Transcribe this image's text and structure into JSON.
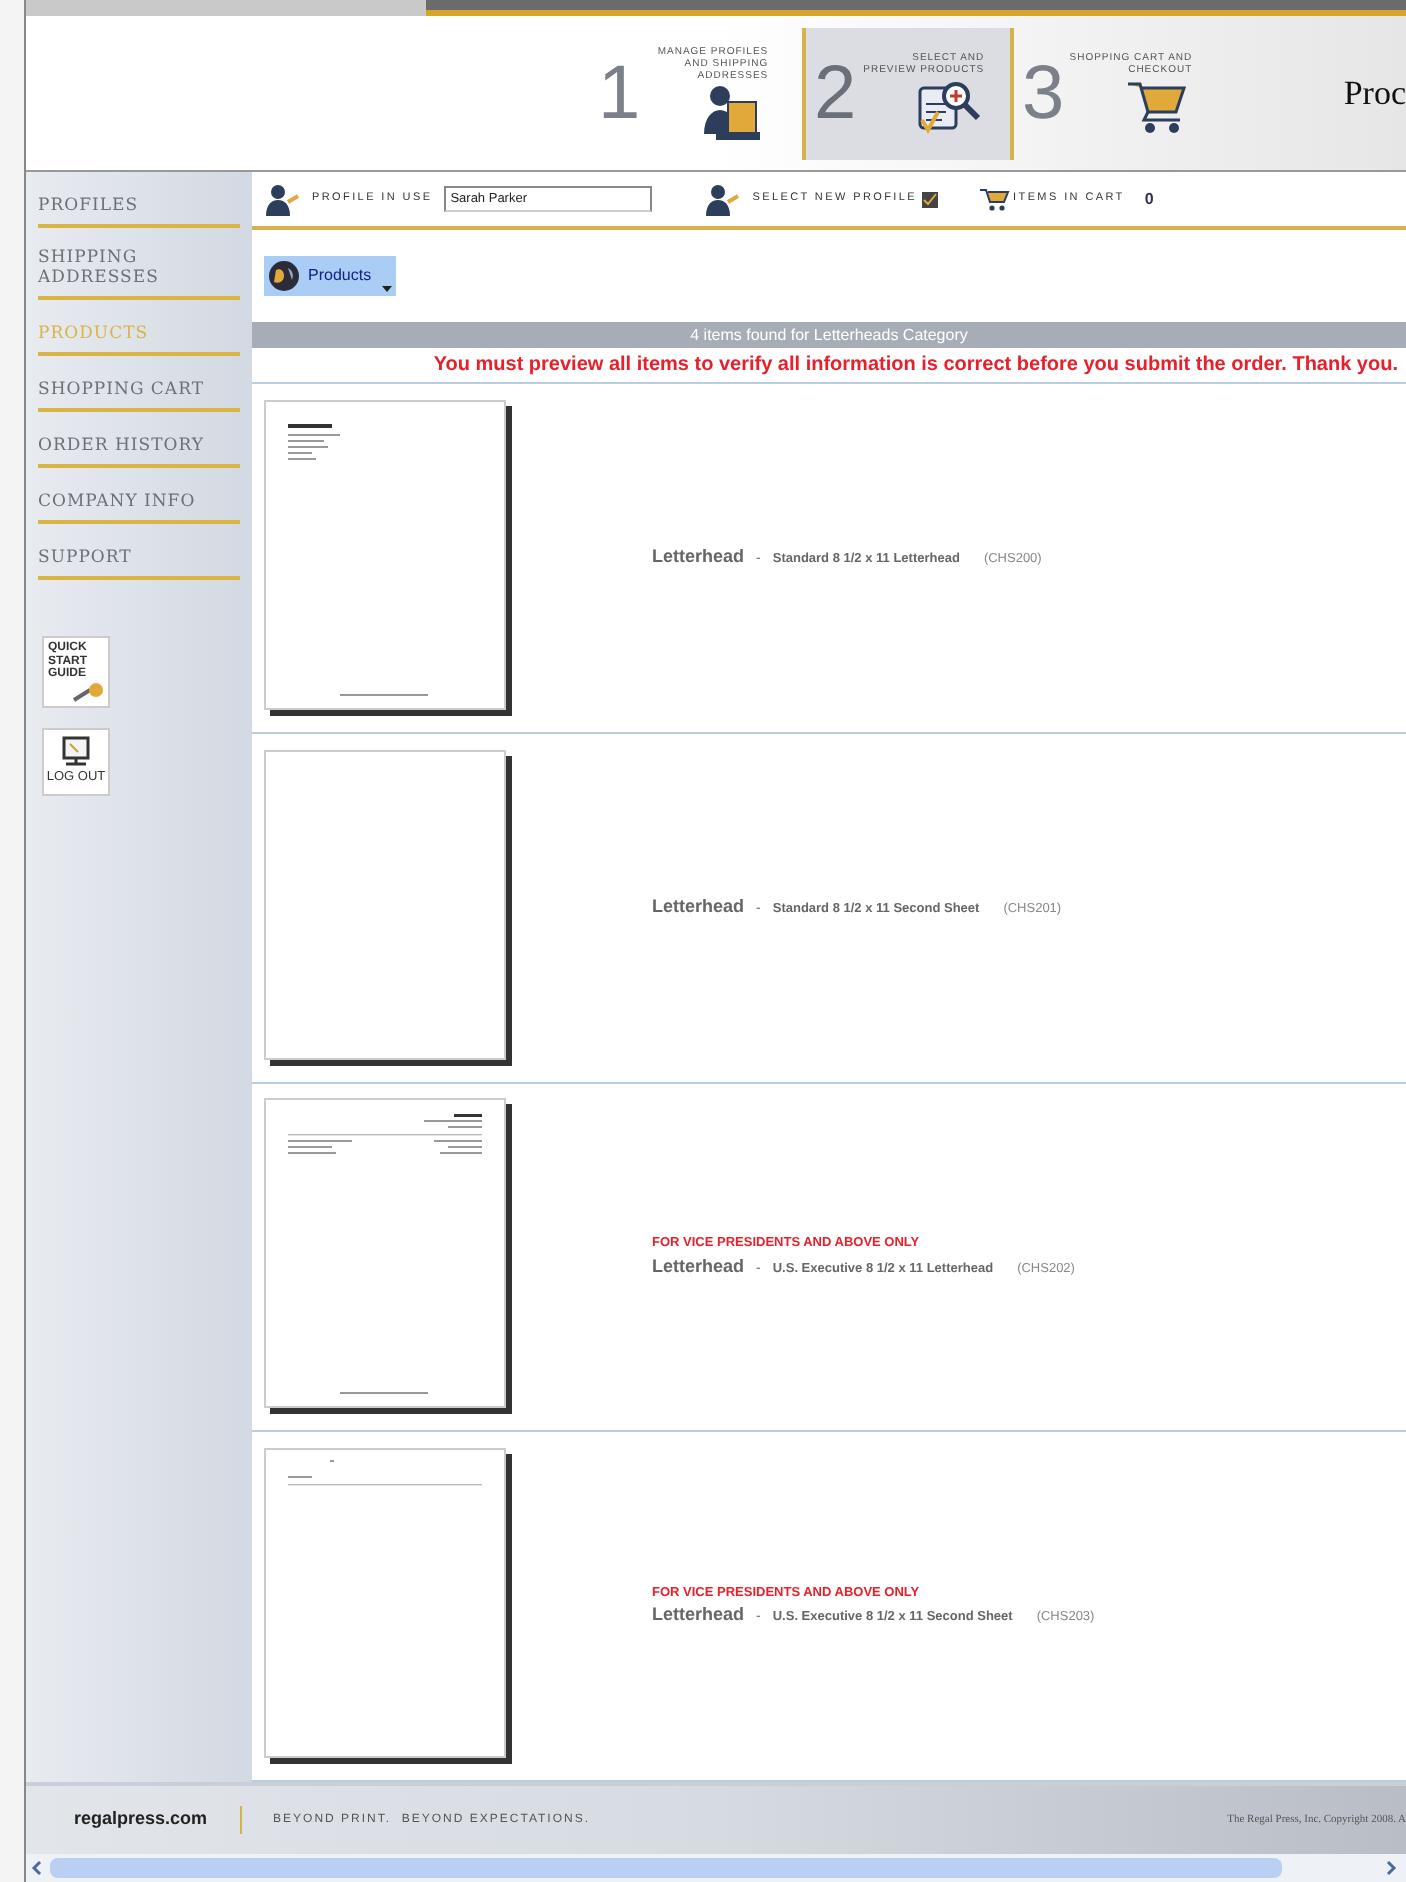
{
  "header": {
    "steps": [
      {
        "number": "1",
        "label": "MANAGE PROFILES AND SHIPPING ADDRESSES",
        "selected": false
      },
      {
        "number": "2",
        "label": "SELECT AND PREVIEW PRODUCTS",
        "selected": true
      },
      {
        "number": "3",
        "label": "SHOPPING CART AND CHECKOUT",
        "selected": false
      }
    ],
    "logo": "Proc"
  },
  "sidebar": {
    "items": [
      {
        "label": "PROFILES",
        "selected": false
      },
      {
        "label": "SHIPPING ADDRESSES",
        "selected": false
      },
      {
        "label": "PRODUCTS",
        "selected": true
      },
      {
        "label": "SHOPPING CART",
        "selected": false
      },
      {
        "label": "ORDER HISTORY",
        "selected": false
      },
      {
        "label": "COMPANY INFO",
        "selected": false
      },
      {
        "label": "SUPPORT",
        "selected": false
      }
    ],
    "quick_start": "QUICK START GUIDE",
    "log_out": "LOG OUT"
  },
  "profile_bar": {
    "profile_label": "PROFILE IN USE",
    "profile_value": "Sarah Parker",
    "select_label": "SELECT NEW PROFILE",
    "cart_label": "ITEMS IN CART",
    "cart_count": "0"
  },
  "products_button": "Products",
  "results_banner": "4 items found for Letterheads Category",
  "warning": "You must preview all items to verify all information is correct before you submit the order. Thank you.",
  "products": [
    {
      "kind": "letter",
      "name": "Letterhead",
      "separator": "-",
      "description": "Standard 8 1/2 x 11 Letterhead",
      "code": "(CHS200)"
    },
    {
      "kind": "blank",
      "name": "Letterhead",
      "separator": "-",
      "description": "Standard 8 1/2 x 11 Second Sheet",
      "code": "(CHS201)"
    },
    {
      "kind": "executive",
      "notice": "FOR VICE PRESIDENTS AND ABOVE ONLY",
      "name": "Letterhead",
      "separator": "-",
      "description": "U.S. Executive 8 1/2 x 11 Letterhead",
      "code": "(CHS202)"
    },
    {
      "kind": "executive_second",
      "notice": "FOR VICE PRESIDENTS AND ABOVE ONLY",
      "name": "Letterhead",
      "separator": "-",
      "description": "U.S. Executive 8 1/2 x 11 Second Sheet",
      "code": "(CHS203)"
    }
  ],
  "footer": {
    "site": "regalpress.com",
    "tagline": "BEYOND PRINT.  BEYOND EXPECTATIONS.",
    "copyright": "The Regal Press, Inc. Copyright 2008. A"
  }
}
